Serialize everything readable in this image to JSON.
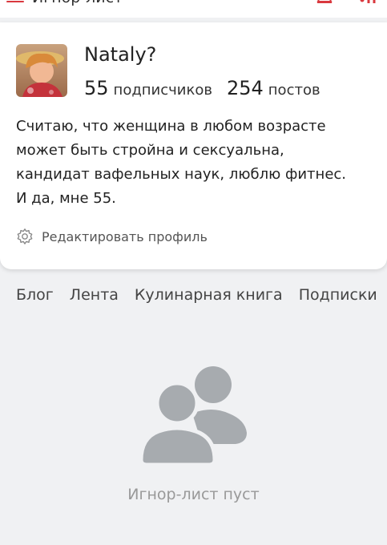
{
  "header": {
    "title": "Игнор-лист",
    "menu_icon": "hamburger-icon",
    "bell_icon": "bell-icon",
    "more_icon": "more-icon"
  },
  "profile": {
    "name": "Nataly?",
    "followers_count": "55",
    "followers_label": "подписчиков",
    "posts_count": "254",
    "posts_label": "постов",
    "bio": "Считаю, что женщина в любом возрасте\nможет быть стройна и сексуальна,\nкандидат вафельных наук, люблю фитнес.\nИ да, мне 55.",
    "edit_label": "Редактировать профиль"
  },
  "tabs": [
    {
      "label": "Блог"
    },
    {
      "label": "Лента"
    },
    {
      "label": "Кулинарная книга"
    },
    {
      "label": "Подписки"
    }
  ],
  "empty_state": {
    "icon": "users-icon",
    "text": "Игнор-лист пуст"
  },
  "colors": {
    "accent": "#d9383e",
    "background": "#f0f1f3",
    "icon_gray": "#a7abaf"
  }
}
